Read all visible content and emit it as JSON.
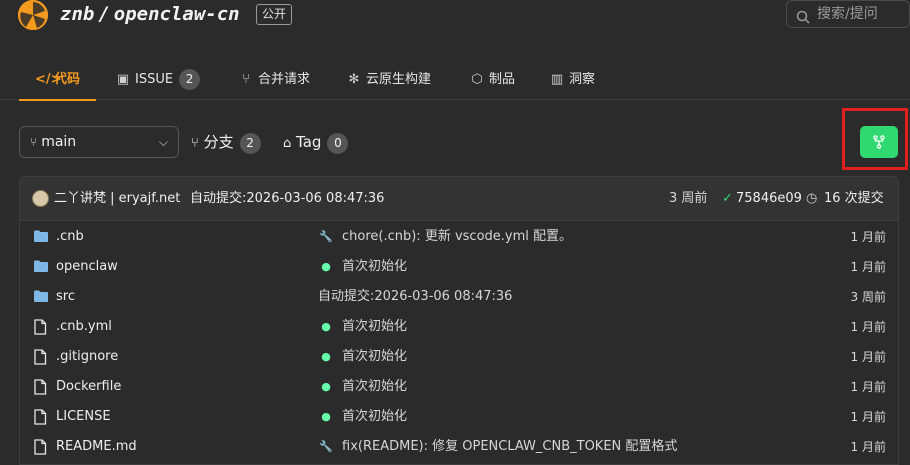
{
  "header": {
    "owner": "znb",
    "separator": "/",
    "repo": "openclaw-cn",
    "visibility": "公开",
    "search_placeholder": "搜索/提问"
  },
  "tabs": [
    {
      "label": "代码",
      "icon": "code-icon",
      "active": true
    },
    {
      "label": "ISSUE",
      "icon": "issue-icon",
      "count": "2"
    },
    {
      "label": "合并请求",
      "icon": "pull-request-icon"
    },
    {
      "label": "云原生构建",
      "icon": "build-icon"
    },
    {
      "label": "制品",
      "icon": "package-icon"
    },
    {
      "label": "洞察",
      "icon": "chart-icon"
    }
  ],
  "branch": {
    "current": "main",
    "branches_label": "分支",
    "branches_count": "2",
    "tags_label": "Tag",
    "tags_count": "0"
  },
  "commit": {
    "author": "二丫讲梵 | eryajf.net",
    "message": "自动提交:2026-03-06 08:47:36",
    "age": "3 周前",
    "sha": "75846e09",
    "total": "16 次提交"
  },
  "files": [
    {
      "name": ".cnb",
      "type": "folder",
      "icon": "folder-icon",
      "msg_icon": "wrench-icon",
      "msg_glyph": "🔧",
      "message": "chore(.cnb): 更新 vscode.yml 配置。",
      "time": "1 月前"
    },
    {
      "name": "openclaw",
      "type": "folder",
      "icon": "folder-icon",
      "msg_icon": "sparkle-icon",
      "msg_glyph": "●",
      "message": "首次初始化",
      "time": "1 月前"
    },
    {
      "name": "src",
      "type": "folder",
      "icon": "folder-icon",
      "msg_icon": "",
      "msg_glyph": "",
      "message": "自动提交:2026-03-06 08:47:36",
      "time": "3 周前"
    },
    {
      "name": ".cnb.yml",
      "type": "file",
      "icon": "file-icon",
      "msg_icon": "sparkle-icon",
      "msg_glyph": "●",
      "message": "首次初始化",
      "time": "1 月前"
    },
    {
      "name": ".gitignore",
      "type": "file",
      "icon": "file-icon",
      "msg_icon": "sparkle-icon",
      "msg_glyph": "●",
      "message": "首次初始化",
      "time": "1 月前"
    },
    {
      "name": "Dockerfile",
      "type": "file",
      "icon": "file-icon",
      "msg_icon": "sparkle-icon",
      "msg_glyph": "●",
      "message": "首次初始化",
      "time": "1 月前"
    },
    {
      "name": "LICENSE",
      "type": "file",
      "icon": "file-icon",
      "msg_icon": "sparkle-icon",
      "msg_glyph": "●",
      "message": "首次初始化",
      "time": "1 月前"
    },
    {
      "name": "README.md",
      "type": "file",
      "icon": "file-icon",
      "msg_icon": "wrench-icon",
      "msg_glyph": "🔧",
      "message": "fix(README): 修复 OPENCLAW_CNB_TOKEN 配置格式",
      "time": "1 月前"
    }
  ],
  "colors": {
    "accent": "#f39a1f",
    "action_green": "#2fd870",
    "highlight_red": "#e0201e",
    "folder": "#7fb8e6"
  }
}
